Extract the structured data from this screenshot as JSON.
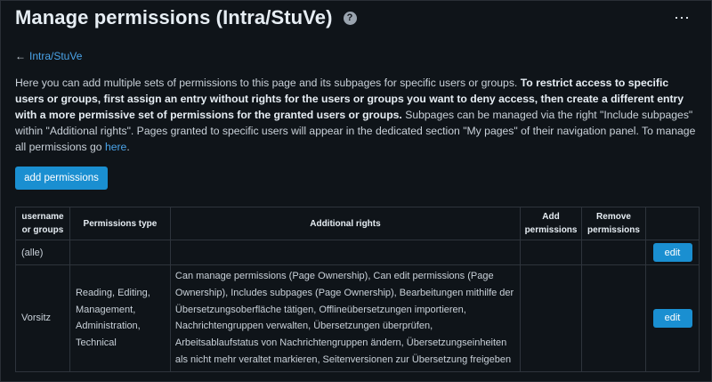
{
  "header": {
    "title": "Manage permissions (Intra/StuVe)",
    "help_glyph": "?",
    "more_glyph": "⋯"
  },
  "nav": {
    "back_arrow": "←",
    "back_label": "Intra/StuVe"
  },
  "intro": {
    "part1": "Here you can add multiple sets of permissions to this page and its subpages for specific users or groups. ",
    "bold": "To restrict access to specific users or groups, first assign an entry without rights for the users or groups you want to deny access, then create a different entry with a more permissive set of permissions for the granted users or groups.",
    "part2": " Subpages can be managed via the right \"Include subpages\" within \"Additional rights\". Pages granted to specific users will appear in the dedicated section \"My pages\" of their navigation panel. To manage all permissions go ",
    "link": "here",
    "part3": "."
  },
  "buttons": {
    "add_permissions": "add permissions",
    "edit": "edit"
  },
  "table": {
    "headers": {
      "username": "username or groups",
      "ptype": "Permissions type",
      "rights": "Additional rights",
      "add": "Add permissions",
      "remove": "Remove permissions"
    },
    "rows": [
      {
        "user": "(alle)",
        "ptype": "",
        "rights": "",
        "add": "",
        "remove": ""
      },
      {
        "user": "Vorsitz",
        "ptype": "Reading, Editing, Management, Administration, Technical",
        "rights": "Can manage permissions (Page Ownership), Can edit permissions (Page Ownership), Includes subpages (Page Ownership), Bearbeitungen mithilfe der Übersetzungsoberfläche tätigen, Offlineübersetzungen importieren, Nachrichtengruppen verwalten, Übersetzungen überprüfen, Arbeitsablaufstatus von Nachrichtengruppen ändern, Übersetzungseinheiten als nicht mehr veraltet markieren, Seitenversionen zur Übersetzung freigeben",
        "add": "",
        "remove": ""
      }
    ]
  },
  "colors": {
    "background": "#0f1419",
    "accent": "#1a8fd1",
    "link": "#4aa3e8"
  }
}
